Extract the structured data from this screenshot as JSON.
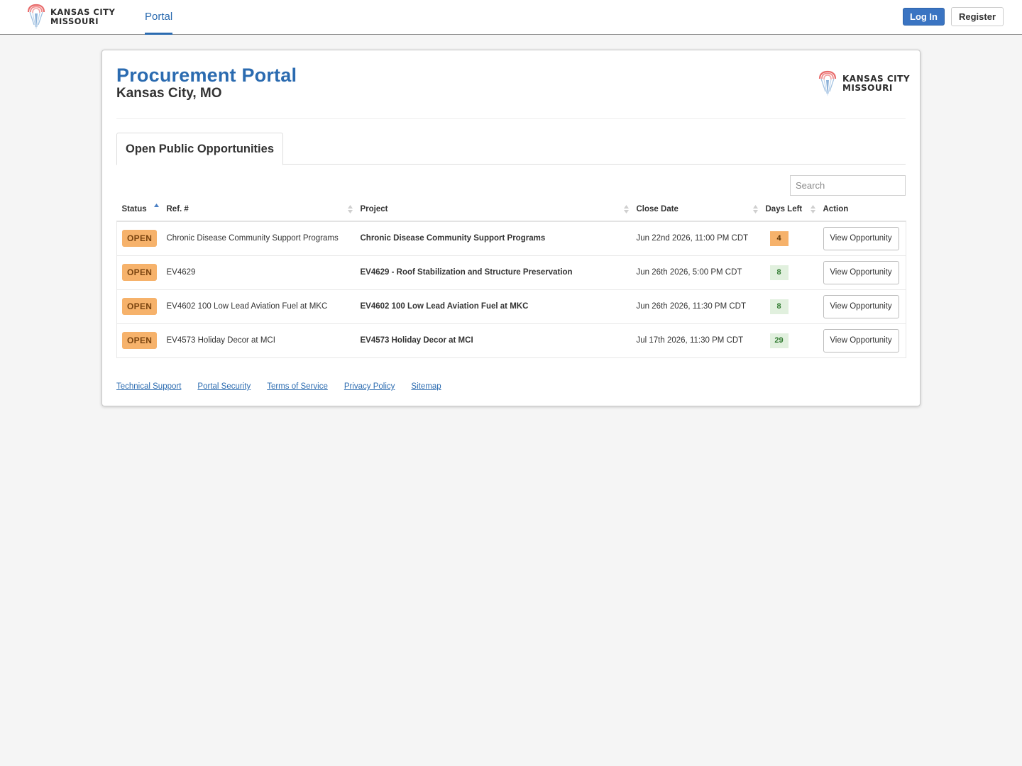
{
  "nav": {
    "logo_line1": "KANSAS CITY",
    "logo_line2": "MISSOURI",
    "active_tab": "Portal",
    "login_label": "Log In",
    "register_label": "Register"
  },
  "header": {
    "title": "Procurement Portal",
    "subtitle": "Kansas City, MO",
    "logo_line1": "KANSAS CITY",
    "logo_line2": "MISSOURI"
  },
  "tabs": [
    {
      "label": "Open Public Opportunities",
      "active": true
    }
  ],
  "search": {
    "placeholder": "Search",
    "value": ""
  },
  "table": {
    "columns": [
      "Status",
      "Ref. #",
      "Project",
      "Close Date",
      "Days Left",
      "Action"
    ],
    "sorted_column": "Status",
    "sort_direction": "ascending",
    "rows": [
      {
        "status": "OPEN",
        "ref": "Chronic Disease Community Support Programs",
        "project": "Chronic Disease Community Support Programs",
        "close_date": "Jun 22nd 2026, 11:00 PM CDT",
        "days_left": "4",
        "days_level": "warn",
        "action": "View Opportunity"
      },
      {
        "status": "OPEN",
        "ref": "EV4629",
        "project": "EV4629 - Roof Stabilization and Structure Preservation",
        "close_date": "Jun 26th 2026, 5:00 PM CDT",
        "days_left": "8",
        "days_level": "ok",
        "action": "View Opportunity"
      },
      {
        "status": "OPEN",
        "ref": "EV4602 100 Low Lead Aviation Fuel at MKC",
        "project": "EV4602 100 Low Lead Aviation Fuel at MKC",
        "close_date": "Jun 26th 2026, 11:30 PM CDT",
        "days_left": "8",
        "days_level": "ok",
        "action": "View Opportunity"
      },
      {
        "status": "OPEN",
        "ref": "EV4573 Holiday Decor at MCI",
        "project": "EV4573 Holiday Decor at MCI",
        "close_date": "Jul 17th 2026, 11:30 PM CDT",
        "days_left": "29",
        "days_level": "ok",
        "action": "View Opportunity"
      }
    ]
  },
  "footer": {
    "links": [
      "Technical Support",
      "Portal Security",
      "Terms of Service",
      "Privacy Policy",
      "Sitemap"
    ]
  },
  "colors": {
    "brand_blue": "#2b6bb0",
    "login_button": "#3a74c2",
    "open_badge": "#f6b26b",
    "days_ok_bg": "#e1f0de",
    "days_ok_text": "#2f7a2f"
  }
}
